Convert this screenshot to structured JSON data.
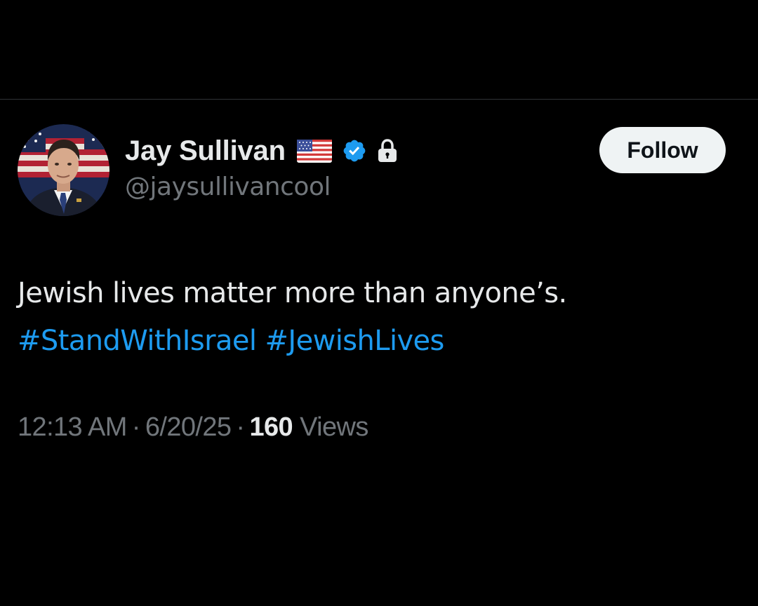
{
  "tweet": {
    "author": {
      "display_name": "Jay Sullivan",
      "handle": "@jaysullivancool",
      "avatar_icon": "person-portrait",
      "badges": [
        "us-flag-icon",
        "verified-icon",
        "lock-icon"
      ]
    },
    "follow_label": "Follow",
    "text": {
      "line1": "Jewish lives matter more than anyone’s.",
      "hashtags": [
        "#StandWithIsrael",
        "#JewishLives"
      ]
    },
    "meta": {
      "time": "12:13 AM",
      "separator": "·",
      "date": "6/20/25",
      "views_count": "160",
      "views_label": "Views"
    }
  },
  "colors": {
    "background": "#000000",
    "text_primary": "#e7e9ea",
    "text_secondary": "#71767b",
    "link": "#1d9bf0",
    "verified": "#1d9bf0",
    "follow_bg": "#eff3f4",
    "divider": "#2f3336"
  }
}
